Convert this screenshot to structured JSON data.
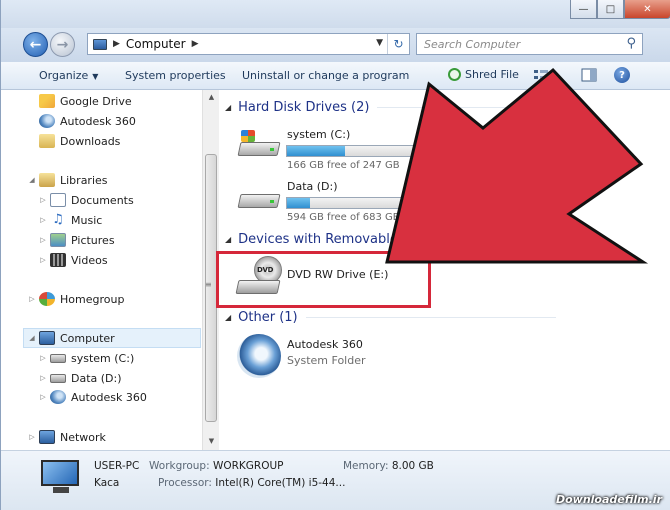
{
  "window": {
    "minimize": "—",
    "maximize": "□",
    "close": "✕"
  },
  "address": {
    "crumb": "Computer",
    "search_placeholder": "Search Computer"
  },
  "toolbar": {
    "organize": "Organize",
    "system_properties": "System properties",
    "uninstall": "Uninstall or change a program",
    "shred": "Shred File",
    "help": "?"
  },
  "nav": {
    "items": [
      {
        "label": "Google Drive"
      },
      {
        "label": "Autodesk 360"
      },
      {
        "label": "Downloads"
      },
      {
        "label": "Libraries"
      },
      {
        "label": "Documents"
      },
      {
        "label": "Music"
      },
      {
        "label": "Pictures"
      },
      {
        "label": "Videos"
      },
      {
        "label": "Homegroup"
      },
      {
        "label": "Computer"
      },
      {
        "label": "system (C:)"
      },
      {
        "label": "Data (D:)"
      },
      {
        "label": "Autodesk 360"
      },
      {
        "label": "Network"
      }
    ]
  },
  "groups": {
    "hdd": "Hard Disk Drives (2)",
    "removable": "Devices with Removable St",
    "other": "Other (1)"
  },
  "drives": [
    {
      "name": "system (C:)",
      "free": "166 GB free of 247 GB",
      "used_fraction": 0.33,
      "bar_color": "#2f8fd0"
    },
    {
      "name": "Data (D:)",
      "free": "594 GB free of 683 GB",
      "used_fraction": 0.13,
      "bar_color": "#2f8fd0"
    }
  ],
  "dvd": {
    "name": "DVD RW Drive (E:)",
    "icon_label": "DVD"
  },
  "other_items": [
    {
      "name": "Autodesk 360",
      "type": "System Folder"
    }
  ],
  "details": {
    "pc_name": "USER-PC",
    "user": "Kaca",
    "workgroup_label": "Workgroup:",
    "workgroup": "WORKGROUP",
    "processor_label": "Processor:",
    "processor": "Intel(R) Core(TM) i5-44...",
    "memory_label": "Memory:",
    "memory": "8.00 GB"
  },
  "colors": {
    "highlight": "#d5283a",
    "arrow": "#d8303f",
    "group_header": "#1e3287"
  },
  "watermark": "Downloadefilm.ir"
}
